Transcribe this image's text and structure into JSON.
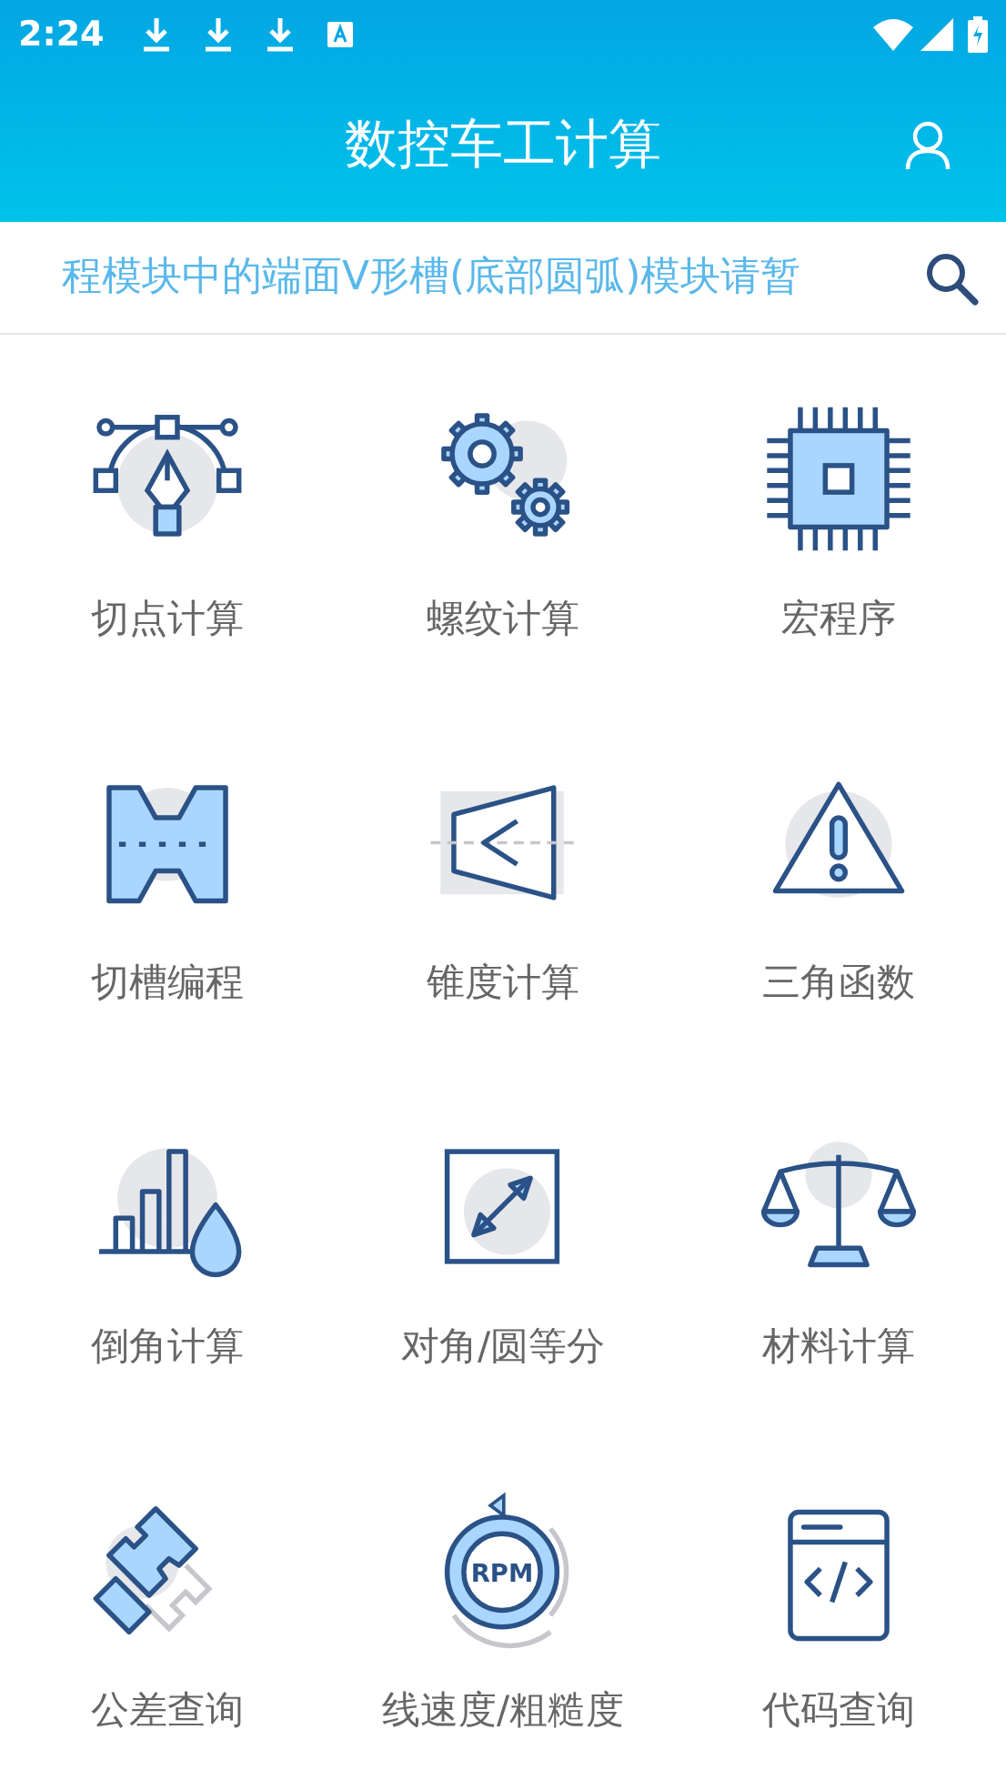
{
  "status_bar": {
    "time": "2:24"
  },
  "app_bar": {
    "title": "数控车工计算"
  },
  "notice": {
    "text": "程模块中的端面V形槽(底部圆弧)模块请暂"
  },
  "modules": [
    {
      "label": "切点计算"
    },
    {
      "label": "螺纹计算"
    },
    {
      "label": "宏程序"
    },
    {
      "label": "切槽编程"
    },
    {
      "label": "锥度计算"
    },
    {
      "label": "三角函数"
    },
    {
      "label": "倒角计算"
    },
    {
      "label": "对角/圆等分"
    },
    {
      "label": "材料计算"
    },
    {
      "label": "公差查询"
    },
    {
      "label": "线速度/粗糙度"
    },
    {
      "label": "代码查询"
    }
  ],
  "speed_icon": {
    "text": "RPM"
  }
}
